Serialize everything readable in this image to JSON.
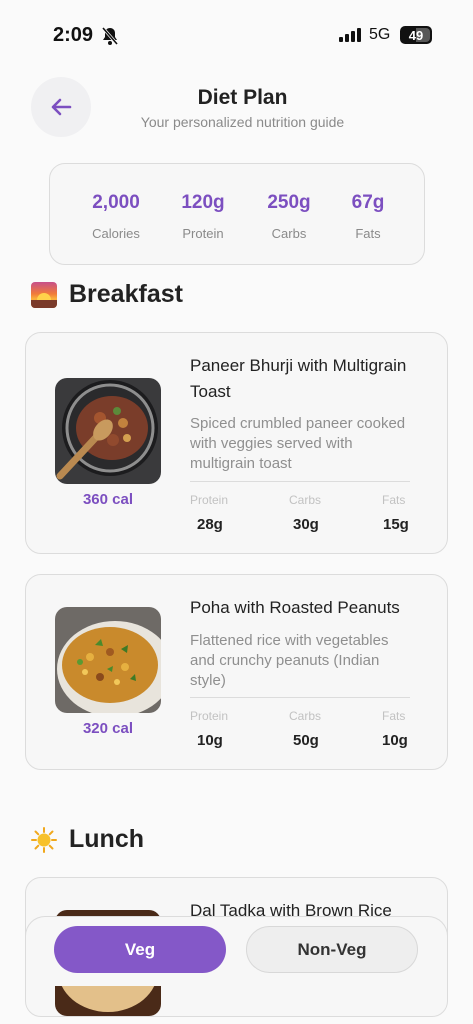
{
  "status": {
    "time": "2:09",
    "network": "5G",
    "battery": "49"
  },
  "header": {
    "title": "Diet Plan",
    "subtitle": "Your personalized nutrition guide"
  },
  "summary": [
    {
      "value": "2,000",
      "label": "Calories"
    },
    {
      "value": "120g",
      "label": "Protein"
    },
    {
      "value": "250g",
      "label": "Carbs"
    },
    {
      "value": "67g",
      "label": "Fats"
    }
  ],
  "sections": {
    "breakfast": {
      "title": "Breakfast",
      "icon": "sunrise-icon"
    },
    "lunch": {
      "title": "Lunch",
      "icon": "sun-icon"
    }
  },
  "macro_labels": {
    "protein": "Protein",
    "carbs": "Carbs",
    "fats": "Fats"
  },
  "meals": [
    {
      "name": "Paneer Bhurji with Multigrain Toast",
      "description": "Spiced crumbled paneer cooked with veggies served with multigrain toast",
      "calories": "360 cal",
      "protein": "28g",
      "carbs": "30g",
      "fats": "15g"
    },
    {
      "name": "Poha with Roasted Peanuts",
      "description": "Flattened rice with vegetables and crunchy peanuts (Indian style)",
      "calories": "320 cal",
      "protein": "10g",
      "carbs": "50g",
      "fats": "10g"
    },
    {
      "name": "Dal Tadka with Brown Rice"
    }
  ],
  "tabs": {
    "veg": "Veg",
    "nonveg": "Non-Veg",
    "active": "Veg"
  },
  "colors": {
    "accent": "#8458c8",
    "accent_text": "#7c4fc0"
  }
}
